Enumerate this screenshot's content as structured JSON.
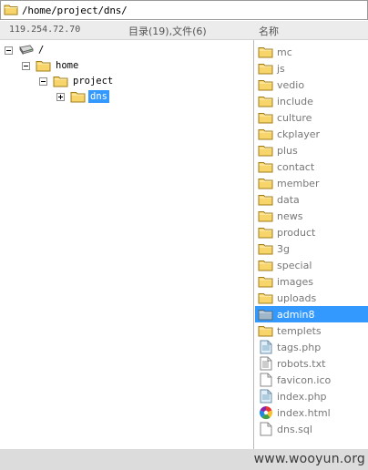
{
  "path_bar": {
    "icon": "folder-icon",
    "path": "/home/project/dns/"
  },
  "info_bar": {
    "ip": "119.254.72.70",
    "counts": "目录(19),文件(6)",
    "column_header": "名称"
  },
  "tree": {
    "nodes": [
      {
        "label": "/",
        "icon": "drive-icon",
        "expander": "minus",
        "selected": false
      },
      {
        "label": "home",
        "icon": "folder-icon",
        "expander": "minus",
        "selected": false
      },
      {
        "label": "project",
        "icon": "folder-icon",
        "expander": "minus",
        "selected": false
      },
      {
        "label": "dns",
        "icon": "folder-icon",
        "expander": "plus",
        "selected": true
      }
    ]
  },
  "files": [
    {
      "name": "mc",
      "icon": "folder-icon",
      "selected": false
    },
    {
      "name": "js",
      "icon": "folder-icon",
      "selected": false
    },
    {
      "name": "vedio",
      "icon": "folder-icon",
      "selected": false
    },
    {
      "name": "include",
      "icon": "folder-icon",
      "selected": false
    },
    {
      "name": "culture",
      "icon": "folder-icon",
      "selected": false
    },
    {
      "name": "ckplayer",
      "icon": "folder-icon",
      "selected": false
    },
    {
      "name": "plus",
      "icon": "folder-icon",
      "selected": false
    },
    {
      "name": "contact",
      "icon": "folder-icon",
      "selected": false
    },
    {
      "name": "member",
      "icon": "folder-icon",
      "selected": false
    },
    {
      "name": "data",
      "icon": "folder-icon",
      "selected": false
    },
    {
      "name": "news",
      "icon": "folder-icon",
      "selected": false
    },
    {
      "name": "product",
      "icon": "folder-icon",
      "selected": false
    },
    {
      "name": "3g",
      "icon": "folder-icon",
      "selected": false
    },
    {
      "name": "special",
      "icon": "folder-icon",
      "selected": false
    },
    {
      "name": "images",
      "icon": "folder-icon",
      "selected": false
    },
    {
      "name": "uploads",
      "icon": "folder-icon",
      "selected": false
    },
    {
      "name": "admin8",
      "icon": "folder-icon",
      "selected": true
    },
    {
      "name": "templets",
      "icon": "folder-icon",
      "selected": false
    },
    {
      "name": "tags.php",
      "icon": "php-file-icon",
      "selected": false
    },
    {
      "name": "robots.txt",
      "icon": "text-file-icon",
      "selected": false
    },
    {
      "name": "favicon.ico",
      "icon": "blank-file-icon",
      "selected": false
    },
    {
      "name": "index.php",
      "icon": "php-file-icon",
      "selected": false
    },
    {
      "name": "index.html",
      "icon": "html-file-icon",
      "selected": false
    },
    {
      "name": "dns.sql",
      "icon": "blank-file-icon",
      "selected": false
    }
  ],
  "watermark": "www.wooyun.org",
  "colors": {
    "selection": "#3399ff",
    "folder": "#f2c94c",
    "header_bg": "#ececec"
  }
}
